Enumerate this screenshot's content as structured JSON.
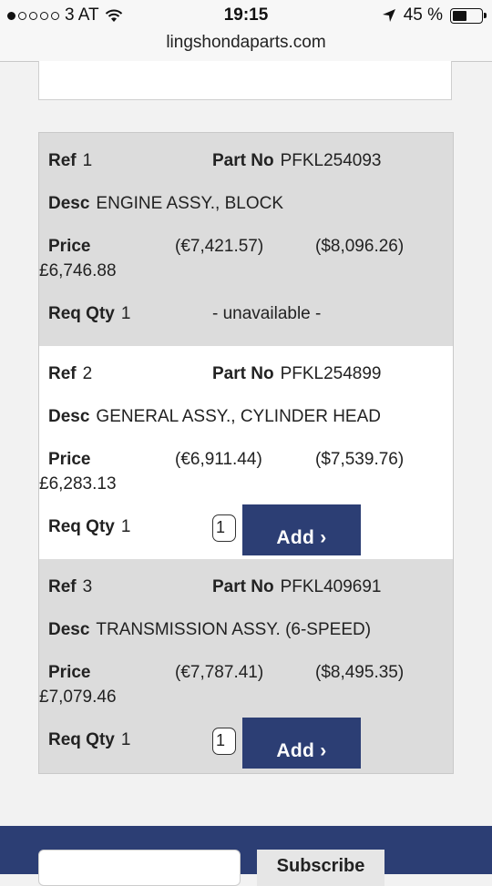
{
  "status_bar": {
    "carrier": "3 AT",
    "time": "19:15",
    "battery": "45 %",
    "battery_level_pct": 45
  },
  "browser": {
    "url": "lingshondaparts.com"
  },
  "labels": {
    "ref": "Ref",
    "part_no": "Part No",
    "desc": "Desc",
    "price": "Price",
    "req_qty": "Req Qty",
    "add": "Add ›"
  },
  "parts": [
    {
      "ref": "1",
      "part_no": "PFKL254093",
      "desc": "ENGINE ASSY., BLOCK",
      "price_eur": "(€7,421.57)",
      "price_usd": "($8,096.26)",
      "price_gbp": "£6,746.88",
      "req_qty": "1",
      "availability": "- unavailable -"
    },
    {
      "ref": "2",
      "part_no": "PFKL254899",
      "desc": "GENERAL ASSY., CYLINDER HEAD",
      "price_eur": "(€6,911.44)",
      "price_usd": "($7,539.76)",
      "price_gbp": "£6,283.13",
      "req_qty": "1",
      "qty_value": "1"
    },
    {
      "ref": "3",
      "part_no": "PFKL409691",
      "desc": "TRANSMISSION ASSY. (6-SPEED)",
      "price_eur": "(€7,787.41)",
      "price_usd": "($8,495.35)",
      "price_gbp": "£7,079.46",
      "req_qty": "1",
      "qty_value": "1"
    }
  ],
  "footer": {
    "subscribe_label": "Subscribe"
  },
  "colors": {
    "accent": "#2c3e74",
    "row_grey": "#dcdcdc"
  }
}
